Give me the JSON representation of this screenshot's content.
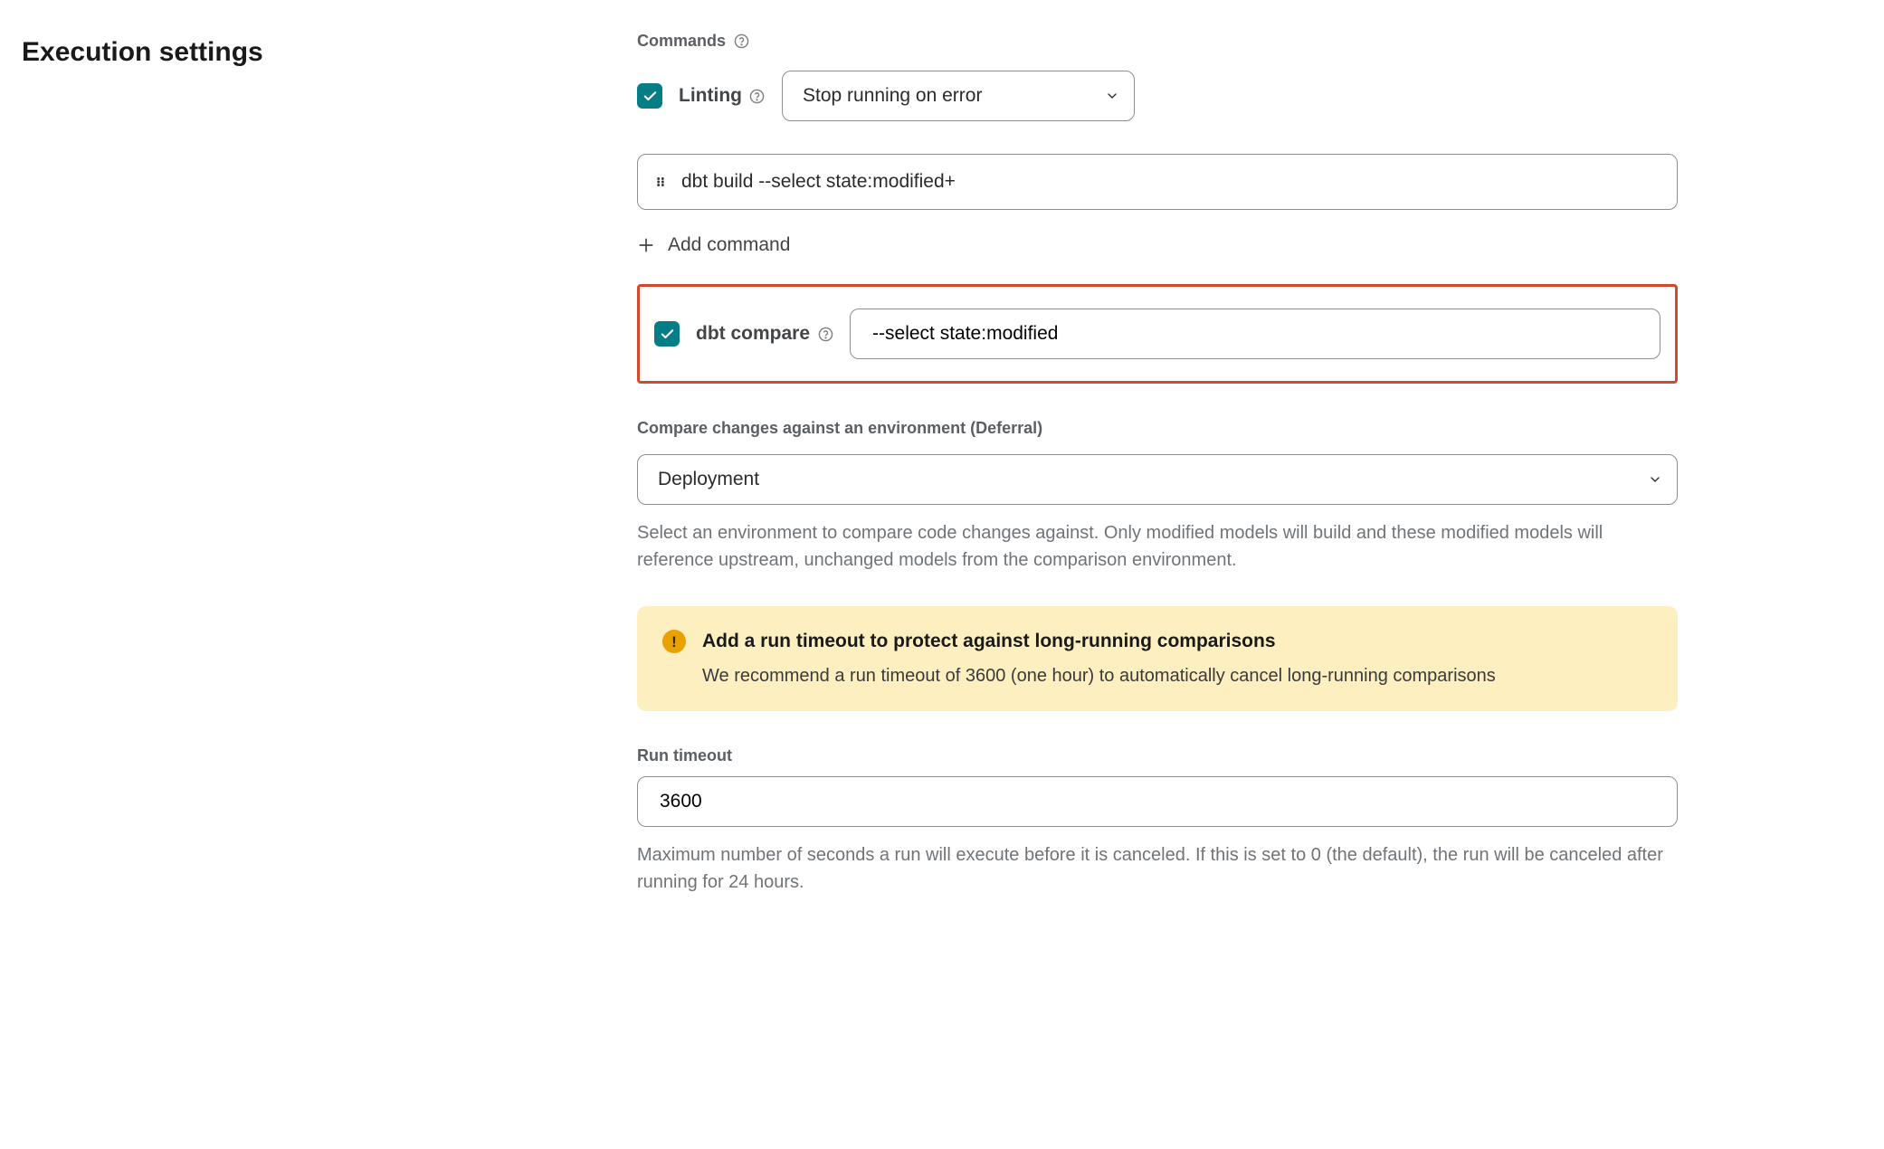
{
  "section_title": "Execution settings",
  "commands": {
    "label": "Commands",
    "linting_label": "Linting",
    "linting_behavior": "Stop running on error",
    "command_value": "dbt build --select state:modified+",
    "add_command_label": "Add command"
  },
  "compare": {
    "label": "dbt compare",
    "value": "--select state:modified"
  },
  "deferral": {
    "label": "Compare changes against an environment (Deferral)",
    "selected": "Deployment",
    "hint": "Select an environment to compare code changes against. Only modified models will build and these modified models will reference upstream, unchanged models from the comparison environment."
  },
  "alert": {
    "title": "Add a run timeout to protect against long-running comparisons",
    "body": "We recommend a run timeout of 3600 (one hour) to automatically cancel long-running comparisons"
  },
  "timeout": {
    "label": "Run timeout",
    "value": "3600",
    "hint": "Maximum number of seconds a run will execute before it is canceled. If this is set to 0 (the default), the run will be canceled after running for 24 hours."
  }
}
